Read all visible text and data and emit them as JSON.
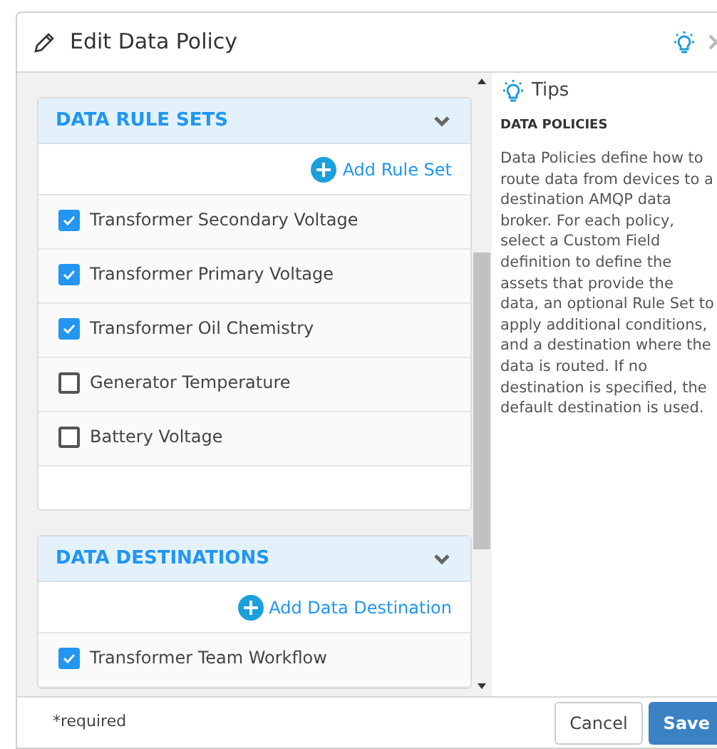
{
  "window": {
    "title": "Edit Data Policy"
  },
  "sections": [
    {
      "title": "DATA RULE SETS",
      "expanded": true,
      "add_label": "Add Rule Set",
      "items": [
        {
          "label": "Transformer Secondary Voltage",
          "checked": true
        },
        {
          "label": "Transformer Primary Voltage",
          "checked": true
        },
        {
          "label": "Transformer Oil Chemistry",
          "checked": true
        },
        {
          "label": "Generator Temperature",
          "checked": false
        },
        {
          "label": "Battery Voltage",
          "checked": false
        }
      ]
    },
    {
      "title": "DATA DESTINATIONS",
      "expanded": true,
      "add_label": "Add Data Destination",
      "items": [
        {
          "label": "Transformer Team Workflow",
          "checked": true
        }
      ]
    }
  ],
  "tips": {
    "title": "Tips",
    "heading": "DATA POLICIES",
    "text": "Data Policies define how to route data from devices to a destination AMQP data broker. For each policy, select a Custom Field definition to define the assets that provide the data, an optional Rule Set to apply additional conditions, and a destination where the data is routed. If no destination is specified, the default destination is used."
  },
  "footer": {
    "note": "*required",
    "buttons": [
      "Cancel",
      "Save"
    ]
  }
}
